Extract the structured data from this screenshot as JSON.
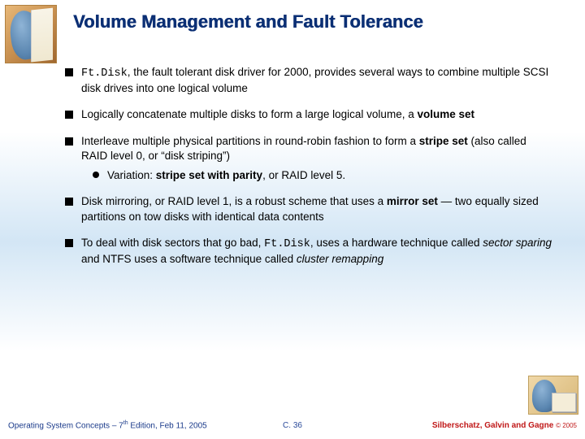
{
  "title": "Volume Management and Fault Tolerance",
  "bullets": {
    "b1_code": "Ft.Disk",
    "b1_rest": ", the fault tolerant disk driver for 2000, provides several ways to combine multiple SCSI disk drives into one logical volume",
    "b2_a": "Logically concatenate multiple disks to form a large logical volume, a ",
    "b2_b": "volume set",
    "b3_a": "Interleave multiple physical partitions in round-robin fashion to form a ",
    "b3_b": "stripe set",
    "b3_c": " (also called RAID level 0, or “disk striping”)",
    "b3_sub_a": "Variation: ",
    "b3_sub_b": "stripe set with parity",
    "b3_sub_c": ", or RAID level 5.",
    "b4_a": "Disk mirroring, or RAID level 1, is a robust scheme that uses a ",
    "b4_b": "mirror set",
    "b4_c": " — two equally sized partitions on tow disks with identical data contents",
    "b5_a": "To deal with disk sectors that go bad, ",
    "b5_code": "Ft.Disk",
    "b5_b": ", uses a hardware technique called ",
    "b5_c": "sector sparing",
    "b5_d": " and NTFS uses a software technique called ",
    "b5_e": "cluster remapping"
  },
  "footer": {
    "left_a": "Operating System Concepts – 7",
    "left_sup": "th",
    "left_b": " Edition, Feb 11, 2005",
    "center": "C. 36",
    "right": "Silberschatz, Galvin and Gagne ",
    "right_copy": "© 2005"
  }
}
